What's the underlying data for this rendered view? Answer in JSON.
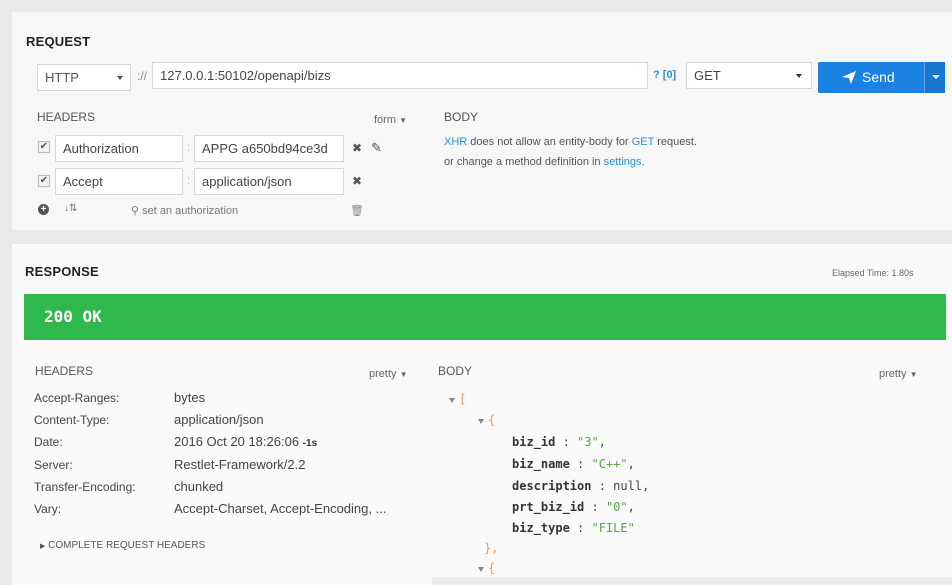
{
  "request": {
    "title": "REQUEST",
    "protocol": "HTTP",
    "scheme_sep": "://",
    "url": "127.0.0.1:50102/openapi/bizs",
    "query_hint": "? [0]",
    "method": "GET",
    "send_label": "Send",
    "headers": {
      "title": "HEADERS",
      "format": "form",
      "rows": [
        {
          "enabled": true,
          "name": "Authorization",
          "value": "APPG a650bd94ce3d"
        },
        {
          "enabled": true,
          "name": "Accept",
          "value": "application/json"
        }
      ],
      "set_auth": "set an authorization"
    },
    "body": {
      "title": "BODY",
      "msg_xhr": "XHR",
      "msg_mid": " does not allow an entity-body for ",
      "msg_get": "GET",
      "msg_end": " request.",
      "msg2_start": "or change a method definition in ",
      "msg2_link": "settings",
      "msg2_end": "."
    }
  },
  "response": {
    "title": "RESPONSE",
    "elapsed": "Elapsed Time: 1.80s",
    "status": "200 OK",
    "status_color": "#2fb84b",
    "headers": {
      "title": "HEADERS",
      "format": "pretty",
      "rows": [
        {
          "name": "Accept-Ranges:",
          "value": "bytes"
        },
        {
          "name": "Content-Type:",
          "value": "application/json"
        },
        {
          "name": "Date:",
          "value": "2016 Oct 20 18:26:06",
          "suffix": "-1s"
        },
        {
          "name": "Server:",
          "value": "Restlet-Framework/2.2"
        },
        {
          "name": "Transfer-Encoding:",
          "value": "chunked"
        },
        {
          "name": "Vary:",
          "value": "Accept-Charset, Accept-Encoding, ..."
        }
      ],
      "complete_link": "COMPLETE REQUEST HEADERS"
    },
    "body": {
      "title": "BODY",
      "format": "pretty",
      "open_array": "[",
      "open_obj": "{",
      "fields": [
        {
          "key": "biz_id",
          "value": "\"3\"",
          "kind": "str",
          "comma": ","
        },
        {
          "key": "biz_name",
          "value": "\"C++\"",
          "kind": "str",
          "comma": ","
        },
        {
          "key": "description",
          "value": "null",
          "kind": "null",
          "comma": ","
        },
        {
          "key": "prt_biz_id",
          "value": "\"0\"",
          "kind": "str",
          "comma": ","
        },
        {
          "key": "biz_type",
          "value": "\"FILE\"",
          "kind": "str",
          "comma": ""
        }
      ],
      "close_obj": "},",
      "open_obj2": "{"
    }
  }
}
